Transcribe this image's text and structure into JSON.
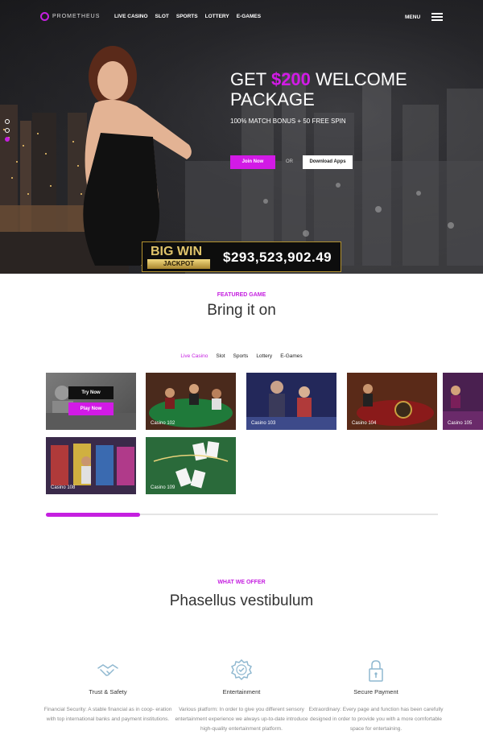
{
  "brand": {
    "name": "PROMETHEUS",
    "accent": "#d21ae6",
    "dark": "#141416"
  },
  "nav": {
    "links": [
      "LIVE CASINO",
      "SLOT",
      "SPORTS",
      "LOTTERY",
      "E-GAMES"
    ],
    "menu_label": "MENU",
    "menu_icon": "hamburger-icon"
  },
  "hero": {
    "headline_prefix": "GET",
    "headline_amount": "$200",
    "headline_suffix": "WELCOME",
    "headline_line2": "PACKAGE",
    "subline": "100% MATCH BONUS + 50 FREE SPIN",
    "join_label": "Join Now",
    "or_label": "OR",
    "download_label": "Download Apps",
    "slide_count": 3,
    "active_slide": 3
  },
  "jackpot": {
    "big": "BIG WIN",
    "label": "JACKPOT",
    "amount": "$293,523,902.49"
  },
  "featured": {
    "kicker": "FEATURED GAME",
    "title": "Bring it on",
    "tabs": [
      "Live Casino",
      "Slot",
      "Sports",
      "Lottery",
      "E-Games"
    ],
    "active_tab": "Live Casino",
    "try_label": "Try Now",
    "play_label": "Play Now",
    "games": [
      "Casino 102",
      "Casino 103",
      "Casino 104",
      "Casino 105",
      "Casino 108",
      "Casino 109"
    ],
    "scroll_progress": 0.24
  },
  "offer": {
    "kicker": "WHAT WE OFFER",
    "title": "Phasellus vestibulum",
    "features": [
      {
        "icon": "handshake-icon",
        "title": "Trust & Safety",
        "text": "Financial Security: A stable financial as in coop- eration with top international banks and payment institutions."
      },
      {
        "icon": "badge-check-icon",
        "title": "Entertainment",
        "text": "Various platform: In order to give you different sensory entertainment experience we always up-to-date introduce high-quality entertainment platform."
      },
      {
        "icon": "lock-icon",
        "title": "Secure Payment",
        "text": "Extraordinary: Every page and function has been carefully designed in order to provide you with a more comfortable space for entertaining."
      }
    ]
  }
}
